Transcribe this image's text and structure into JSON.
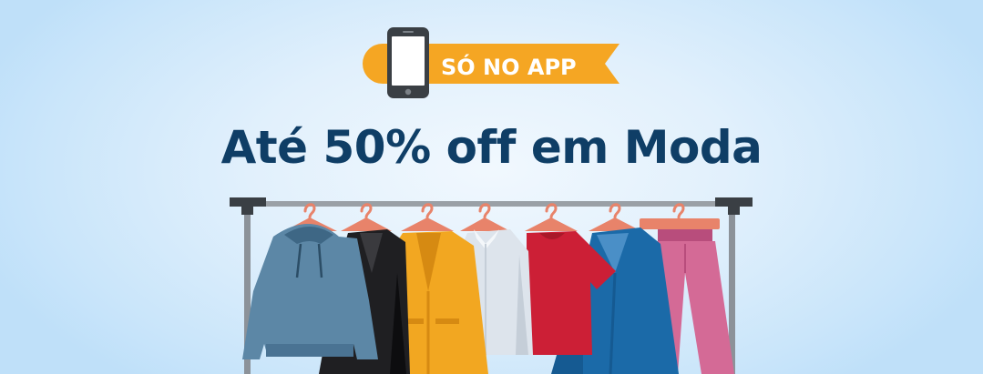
{
  "badge": {
    "label": "SÓ NO APP",
    "icon": "smartphone-icon",
    "color": "#f5a623"
  },
  "headline": {
    "text": "Até 50% off em Moda",
    "color": "#0f3e66"
  },
  "illustration": {
    "name": "clothing-rack",
    "garments": [
      "gray-blue-hoodie",
      "black-blazer",
      "yellow-blazer",
      "white-shirt",
      "red-tshirt",
      "blue-coat",
      "pink-trousers"
    ]
  }
}
